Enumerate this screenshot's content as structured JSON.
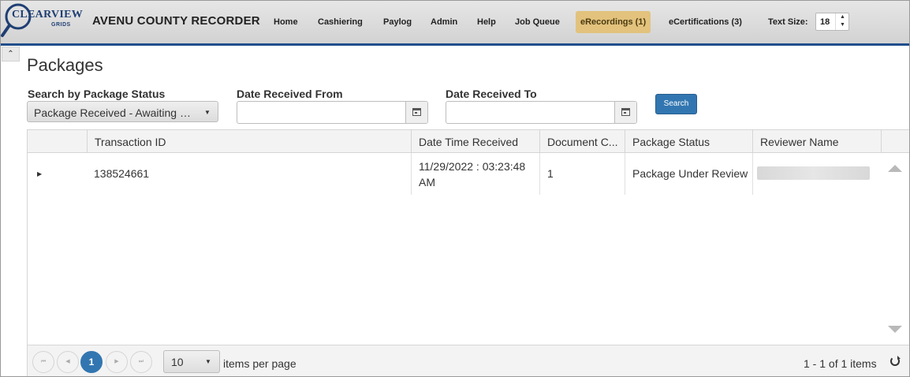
{
  "header": {
    "logo_text": "CLEARVIEW",
    "logo_sub": "GRIDS",
    "app_title": "AVENU COUNTY RECORDER",
    "nav": [
      "Home",
      "Cashiering",
      "Paylog",
      "Admin",
      "Help",
      "Job Queue",
      "eRecordings (1)",
      "eCertifications (3)"
    ],
    "active_nav": "eRecordings (1)",
    "text_size_label": "Text Size:",
    "text_size_value": "18",
    "accent_color": "#1f4e8c",
    "active_color": "#e2c27c"
  },
  "page": {
    "title": "Packages"
  },
  "filters": {
    "status_label": "Search by Package Status",
    "status_value": "Package Received - Awaiting Review",
    "from_label": "Date Received From",
    "from_value": "",
    "to_label": "Date Received To",
    "to_value": "",
    "search_label": "Search"
  },
  "grid": {
    "columns": [
      "Transaction ID",
      "Date Time Received",
      "Document C...",
      "Package Status",
      "Reviewer Name"
    ],
    "rows": [
      {
        "transaction_id": "138524661",
        "date_line1": "11/29/2022 : 03:23:48",
        "date_line2": "AM",
        "document_count": "1",
        "package_status": "Package Under Review",
        "reviewer_name": ""
      }
    ]
  },
  "pager": {
    "current_page": "1",
    "page_size": "10",
    "items_per_page_label": "items per page",
    "summary": "1 - 1 of 1 items",
    "button_color": "#3276b1"
  }
}
